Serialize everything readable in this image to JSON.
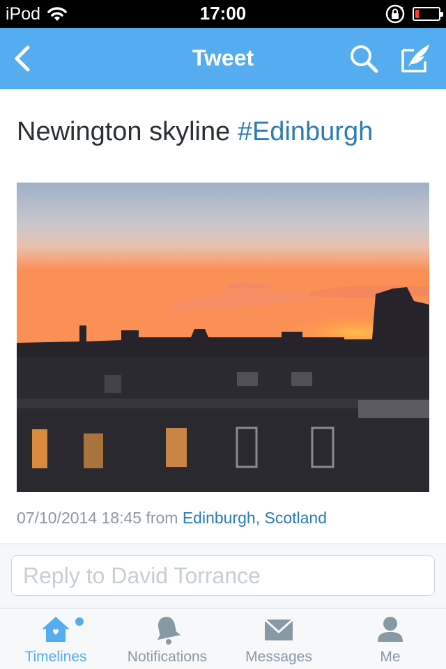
{
  "status_bar": {
    "carrier": "iPod",
    "time": "17:00"
  },
  "nav": {
    "title": "Tweet"
  },
  "tweet": {
    "text": "Newington skyline ",
    "hashtag": "#Edinburgh",
    "timestamp": "07/10/2014 18:45 from ",
    "location": "Edinburgh, Scotland"
  },
  "reply": {
    "placeholder": "Reply to David Torrance"
  },
  "tabs": [
    {
      "label": "Timelines",
      "icon": "home-icon",
      "active": true
    },
    {
      "label": "Notifications",
      "icon": "bell-icon",
      "active": false
    },
    {
      "label": "Messages",
      "icon": "envelope-icon",
      "active": false
    },
    {
      "label": "Me",
      "icon": "person-icon",
      "active": false
    }
  ],
  "colors": {
    "accent": "#55acee",
    "link": "#2b7bb9",
    "text": "#292f33",
    "muted": "#8899a6",
    "battery_low": "#ff3b30"
  }
}
